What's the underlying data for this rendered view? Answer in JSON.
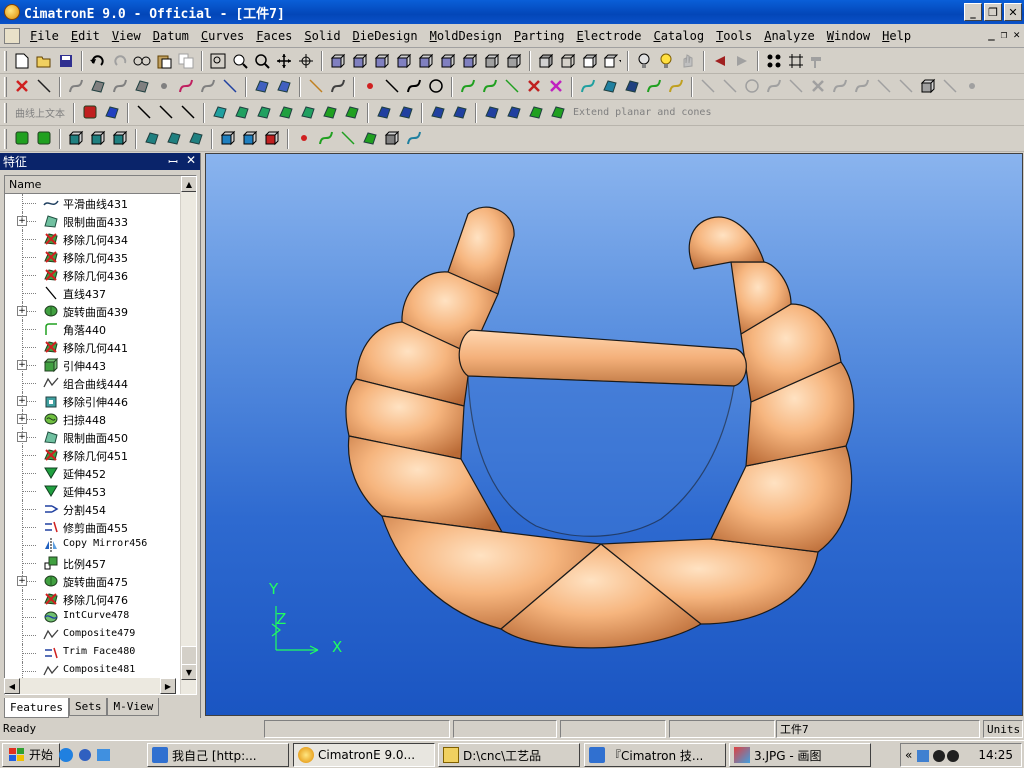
{
  "window": {
    "title": "CimatronE 9.0 - Official - [工件7]",
    "controls": [
      "_",
      "❐",
      "✕"
    ]
  },
  "menubar": {
    "items": [
      {
        "key": "F",
        "rest": "ile"
      },
      {
        "key": "E",
        "rest": "dit"
      },
      {
        "key": "V",
        "rest": "iew"
      },
      {
        "key": "D",
        "rest": "atum"
      },
      {
        "key": "C",
        "rest": "urves"
      },
      {
        "key": "F",
        "rest": "aces"
      },
      {
        "key": "S",
        "rest": "olid"
      },
      {
        "key": "D",
        "rest": "ieDesign"
      },
      {
        "key": "M",
        "rest": "oldDesign"
      },
      {
        "key": "P",
        "rest": "arting"
      },
      {
        "key": "E",
        "rest": "lectrode"
      },
      {
        "key": "C",
        "rest": "atalog"
      },
      {
        "key": "T",
        "rest": "ools"
      },
      {
        "key": "A",
        "rest": "nalyze"
      },
      {
        "key": "W",
        "rest": "indow"
      },
      {
        "key": "H",
        "rest": "elp"
      }
    ],
    "mdi_controls": [
      "_",
      "❐",
      "✕"
    ]
  },
  "toolbar3": {
    "text_label": "曲线上文本",
    "extend_label": "Extend planar and cones"
  },
  "panel": {
    "title": "特征",
    "controls": [
      "ꟷ",
      "✕"
    ],
    "column_header": "Name",
    "tabs": [
      "Features",
      "Sets",
      "M-View"
    ],
    "rows": [
      {
        "label": "平滑曲线431",
        "icon": "curve-icon",
        "expand": false,
        "mono": false
      },
      {
        "label": "限制曲面433",
        "icon": "surface-icon",
        "expand": true,
        "mono": false
      },
      {
        "label": "移除几何434",
        "icon": "remove-geometry-icon",
        "expand": false,
        "mono": false
      },
      {
        "label": "移除几何435",
        "icon": "remove-geometry-icon",
        "expand": false,
        "mono": false
      },
      {
        "label": "移除几何436",
        "icon": "remove-geometry-icon",
        "expand": false,
        "mono": false
      },
      {
        "label": "直线437",
        "icon": "line-icon",
        "expand": false,
        "mono": false
      },
      {
        "label": "旋转曲面439",
        "icon": "revolve-surface-icon",
        "expand": true,
        "mono": false
      },
      {
        "label": "角落440",
        "icon": "corner-icon",
        "expand": false,
        "mono": false
      },
      {
        "label": "移除几何441",
        "icon": "remove-geometry-icon",
        "expand": false,
        "mono": false
      },
      {
        "label": "引伸443",
        "icon": "extrude-icon",
        "expand": true,
        "mono": false
      },
      {
        "label": "组合曲线444",
        "icon": "composite-curve-icon",
        "expand": false,
        "mono": false
      },
      {
        "label": "移除引伸446",
        "icon": "remove-extrude-icon",
        "expand": true,
        "mono": false
      },
      {
        "label": "扫掠448",
        "icon": "sweep-icon",
        "expand": true,
        "mono": false
      },
      {
        "label": "限制曲面450",
        "icon": "surface-icon",
        "expand": true,
        "mono": false
      },
      {
        "label": "移除几何451",
        "icon": "remove-geometry-icon",
        "expand": false,
        "mono": false
      },
      {
        "label": "延伸452",
        "icon": "extend-icon",
        "expand": false,
        "mono": false
      },
      {
        "label": "延伸453",
        "icon": "extend-icon",
        "expand": false,
        "mono": false
      },
      {
        "label": "分割454",
        "icon": "split-icon",
        "expand": false,
        "mono": false
      },
      {
        "label": "修剪曲面455",
        "icon": "trim-icon",
        "expand": false,
        "mono": false
      },
      {
        "label": "Copy Mirror456",
        "icon": "mirror-icon",
        "expand": false,
        "mono": true
      },
      {
        "label": "比例457",
        "icon": "scale-icon",
        "expand": false,
        "mono": false
      },
      {
        "label": "旋转曲面475",
        "icon": "revolve-surface-icon",
        "expand": true,
        "mono": false
      },
      {
        "label": "移除几何476",
        "icon": "remove-geometry-icon",
        "expand": false,
        "mono": false
      },
      {
        "label": "IntCurve478",
        "icon": "intcurve-icon",
        "expand": false,
        "mono": true
      },
      {
        "label": "Composite479",
        "icon": "composite-curve-icon",
        "expand": false,
        "mono": true
      },
      {
        "label": "Trim Face480",
        "icon": "trim-icon",
        "expand": false,
        "mono": true
      },
      {
        "label": "Composite481",
        "icon": "composite-curve-icon",
        "expand": false,
        "mono": true
      }
    ]
  },
  "viewport": {
    "axis_y": "Y",
    "axis_z": "Z",
    "axis_x": "X",
    "background_top": "#8ab4ee",
    "background_bottom": "#1a55c2",
    "model_color": "#f2b27c"
  },
  "statusbar": {
    "status": "Ready",
    "document": "工件7",
    "units": "Units:"
  },
  "taskbar": {
    "start": "开始",
    "tasks": [
      "我自己 [http:...",
      "CimatronE 9.0...",
      "D:\\cnc\\工艺品",
      "『Cimatron 技...",
      "3.JPG - 画图"
    ],
    "clock": "14:25"
  }
}
